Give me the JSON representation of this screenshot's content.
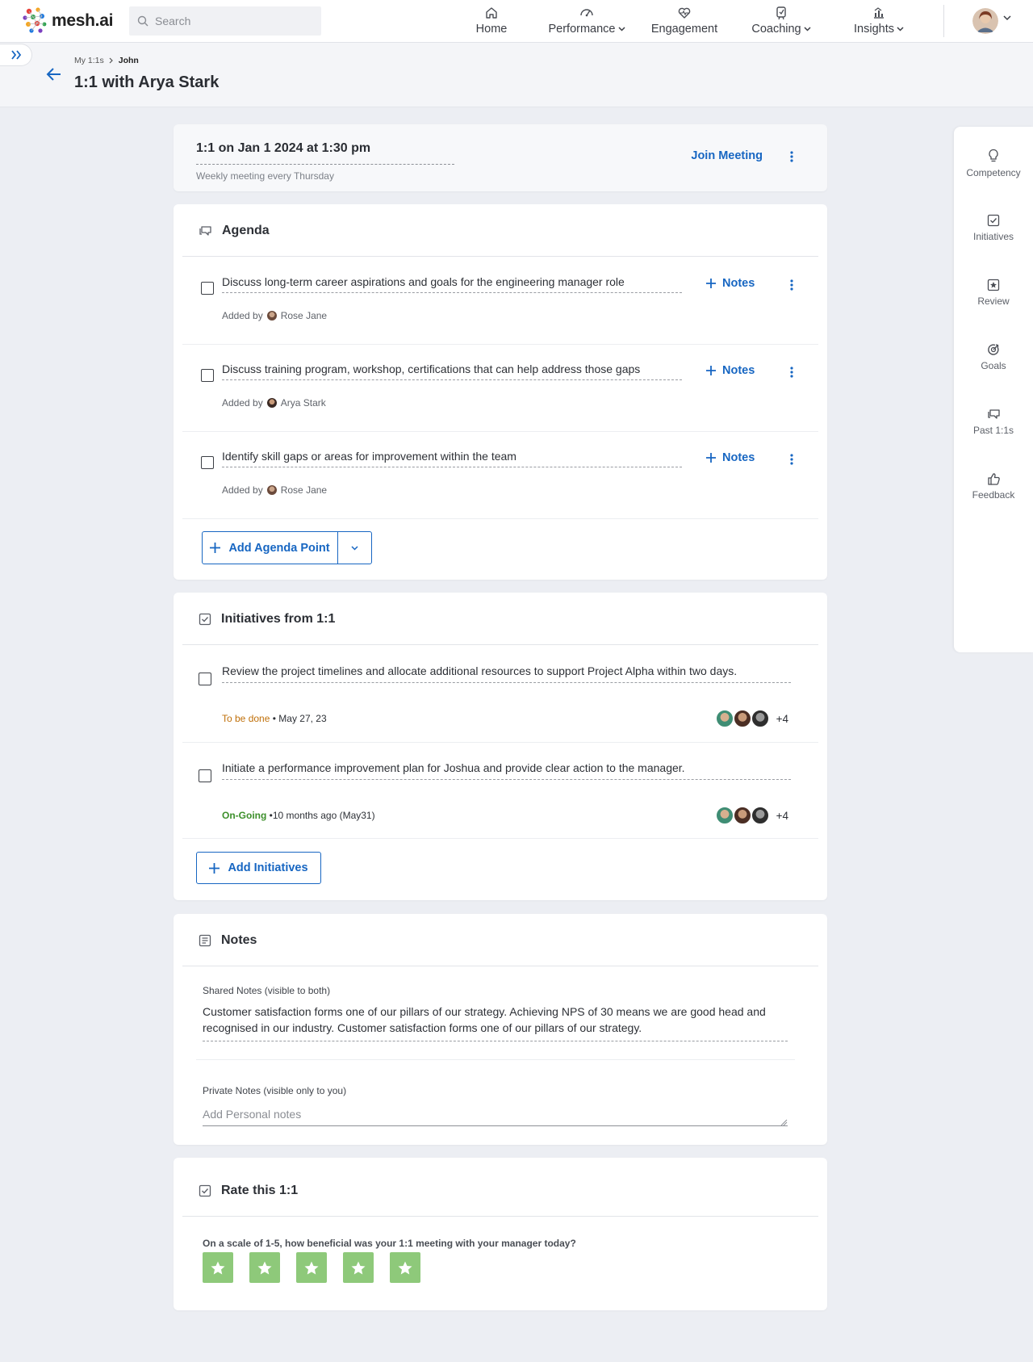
{
  "app": {
    "brand": "mesh.ai"
  },
  "search": {
    "placeholder": "Search"
  },
  "nav": [
    {
      "label": "Home",
      "icon": "home-icon"
    },
    {
      "label": "Performance",
      "icon": "performance-icon",
      "has_dropdown": true
    },
    {
      "label": "Engagement",
      "icon": "engagement-icon"
    },
    {
      "label": "Coaching",
      "icon": "coaching-icon",
      "has_dropdown": true
    },
    {
      "label": "Insights",
      "icon": "insights-icon",
      "has_dropdown": true
    }
  ],
  "breadcrumb": {
    "parent": "My 1:1s",
    "current": "John"
  },
  "page": {
    "title": "1:1 with Arya Stark"
  },
  "meeting": {
    "title": "1:1 on Jan 1 2024 at 1:30 pm",
    "subtitle": "Weekly meeting every Thursday",
    "join_label": "Join Meeting"
  },
  "agenda": {
    "title": "Agenda",
    "items": [
      {
        "text": "Discuss long-term career aspirations and goals for the engineering manager role",
        "added_by_prefix": "Added by",
        "author": "Rose Jane",
        "notes_label": "Notes",
        "checked": false
      },
      {
        "text": "Discuss training program, workshop, certifications that can help address those gaps",
        "added_by_prefix": "Added by",
        "author": "Arya Stark",
        "notes_label": "Notes",
        "checked": false
      },
      {
        "text": "Identify skill gaps or areas for improvement within the team",
        "added_by_prefix": "Added by",
        "author": "Rose Jane",
        "notes_label": "Notes",
        "checked": false
      }
    ],
    "add_label": "Add Agenda Point"
  },
  "initiatives": {
    "title": "Initiatives from 1:1",
    "items": [
      {
        "text": "Review the project timelines and allocate additional resources to support Project Alpha within two days.",
        "status": "To be done",
        "status_color": "#c0700a",
        "date": "• May 27, 23",
        "more": "+4"
      },
      {
        "text": "Initiate a performance improvement plan for Joshua and provide clear action to the manager.",
        "status": "On-Going",
        "status_color": "#3c8f2a",
        "date": "•10 months ago (May31)",
        "more": "+4"
      }
    ],
    "add_label": "Add Initiatives"
  },
  "notes": {
    "title": "Notes",
    "shared_label": "Shared Notes (visible to both)",
    "shared_text": "Customer satisfaction forms one of our pillars of our strategy. Achieving NPS of 30 means we are good head and recognised in our industry. Customer satisfaction forms one of our pillars of our strategy.",
    "private_label": "Private Notes (visible only to you)",
    "private_placeholder": "Add Personal notes"
  },
  "rating": {
    "title": "Rate this 1:1",
    "question": "On a scale of 1-5, how beneficial was your 1:1 meeting with your manager today?",
    "max": 5,
    "value": 5,
    "star_color": "#8ec97a"
  },
  "rail": [
    {
      "label": "Competency",
      "icon": "lightbulb-icon"
    },
    {
      "label": "Initiatives",
      "icon": "checkbox-icon"
    },
    {
      "label": "Review",
      "icon": "star-box-icon"
    },
    {
      "label": "Goals",
      "icon": "target-icon"
    },
    {
      "label": "Past 1:1s",
      "icon": "chat-icon"
    },
    {
      "label": "Feedback",
      "icon": "thumbs-up-icon"
    }
  ],
  "colors": {
    "accent": "#1766c2",
    "background": "#eceef3"
  }
}
